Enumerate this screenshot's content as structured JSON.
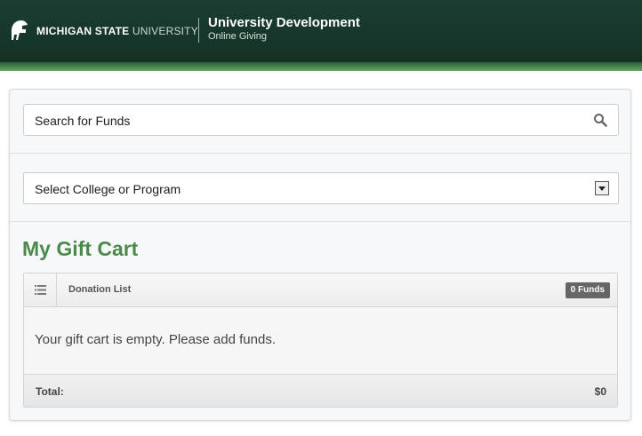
{
  "header": {
    "university_bold": "MICHIGAN STATE",
    "university_light": "UNIVERSITY",
    "department_title": "University Development",
    "department_subtitle": "Online Giving"
  },
  "search": {
    "label": "Search for Funds"
  },
  "college_select": {
    "selected": "Select College or Program"
  },
  "cart": {
    "title": "My Gift Cart",
    "list_label": "Donation List",
    "funds_badge": "0 Funds",
    "empty_message": "Your gift cart is empty. Please add funds.",
    "total_label": "Total:",
    "total_value": "$0"
  },
  "colors": {
    "banner": "#17362b",
    "accent_green": "#4b8a4a"
  }
}
